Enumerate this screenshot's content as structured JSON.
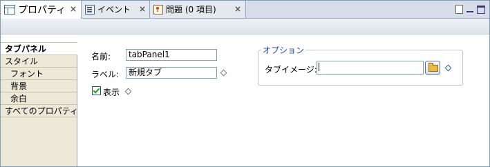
{
  "tabs": [
    {
      "label": "プロパティ",
      "icon": "properties-icon",
      "active": true
    },
    {
      "label": "イベント",
      "icon": "events-icon",
      "active": false
    },
    {
      "label": "問題 (0 項目)",
      "icon": "problems-icon",
      "active": false
    }
  ],
  "close_glyph": "×",
  "categories": [
    {
      "label": "タブパネル",
      "selected": true
    },
    {
      "label": "スタイル"
    },
    {
      "label": "フォント"
    },
    {
      "label": "背景"
    },
    {
      "label": "余白"
    },
    {
      "label": "すべてのプロパティ"
    }
  ],
  "form": {
    "name_label": "名前:",
    "name_value": "tabPanel1",
    "label_label": "ラベル:",
    "label_value": "新規タブ",
    "show_label": "表示",
    "show_checked": true
  },
  "options": {
    "title": "オプション",
    "tab_image_label": "タブイメージ:",
    "tab_image_value": ""
  }
}
